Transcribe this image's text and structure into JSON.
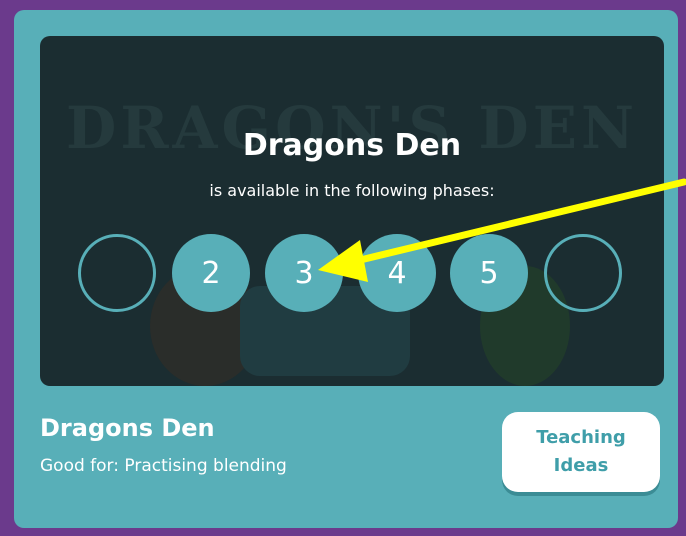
{
  "banner": {
    "watermark": "DRAGON'S DEN",
    "overlay_title": "Dragons Den",
    "overlay_subtitle": "is available in the following phases:",
    "phases": [
      "",
      "2",
      "3",
      "4",
      "5",
      ""
    ]
  },
  "card": {
    "title": "Dragons Den",
    "subtitle": "Good for: Practising blending",
    "button_line1": "Teaching",
    "button_line2": "Ideas"
  },
  "colors": {
    "frame": "#6b3a8c",
    "card": "#58afb8",
    "banner": "#1b2d31",
    "arrow": "#ffff00"
  }
}
